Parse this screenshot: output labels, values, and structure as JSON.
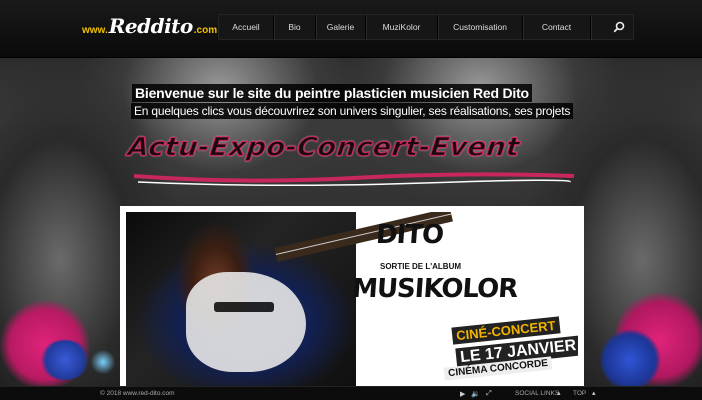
{
  "brand": {
    "prefix": "www.",
    "name": "Reddito",
    "suffix": ".com",
    "logo_color": "#f2c200"
  },
  "nav": {
    "items": [
      "Accueil",
      "Bio",
      "Galerie",
      "MuziKolor",
      "Customisation",
      "Contact"
    ],
    "search_icon": "search-icon"
  },
  "welcome": {
    "line1": "Bienvenue sur le site du peintre plasticien musicien Red Dito",
    "line2": "En quelques clics vous découvrirez son univers singulier, ses réalisations, ses projets"
  },
  "banner": {
    "text": "Actu-Expo-Concert-Event",
    "accent": "#c8265f"
  },
  "poster": {
    "title1": "DITO",
    "subtitle": "SORTIE DE L'ALBUM",
    "title2": "MUSIKOLOR",
    "event1": "CINÉ-CONCERT",
    "event2": "LE 17 JANVIER",
    "event3": "CINÉMA CONCORDE"
  },
  "footer": {
    "copyright": "© 2018 www.red-dito.com",
    "controls": [
      "play-icon",
      "volume-icon",
      "fullscreen-icon"
    ],
    "social_links": "SOCIAL LINKS",
    "top": "TOP"
  }
}
